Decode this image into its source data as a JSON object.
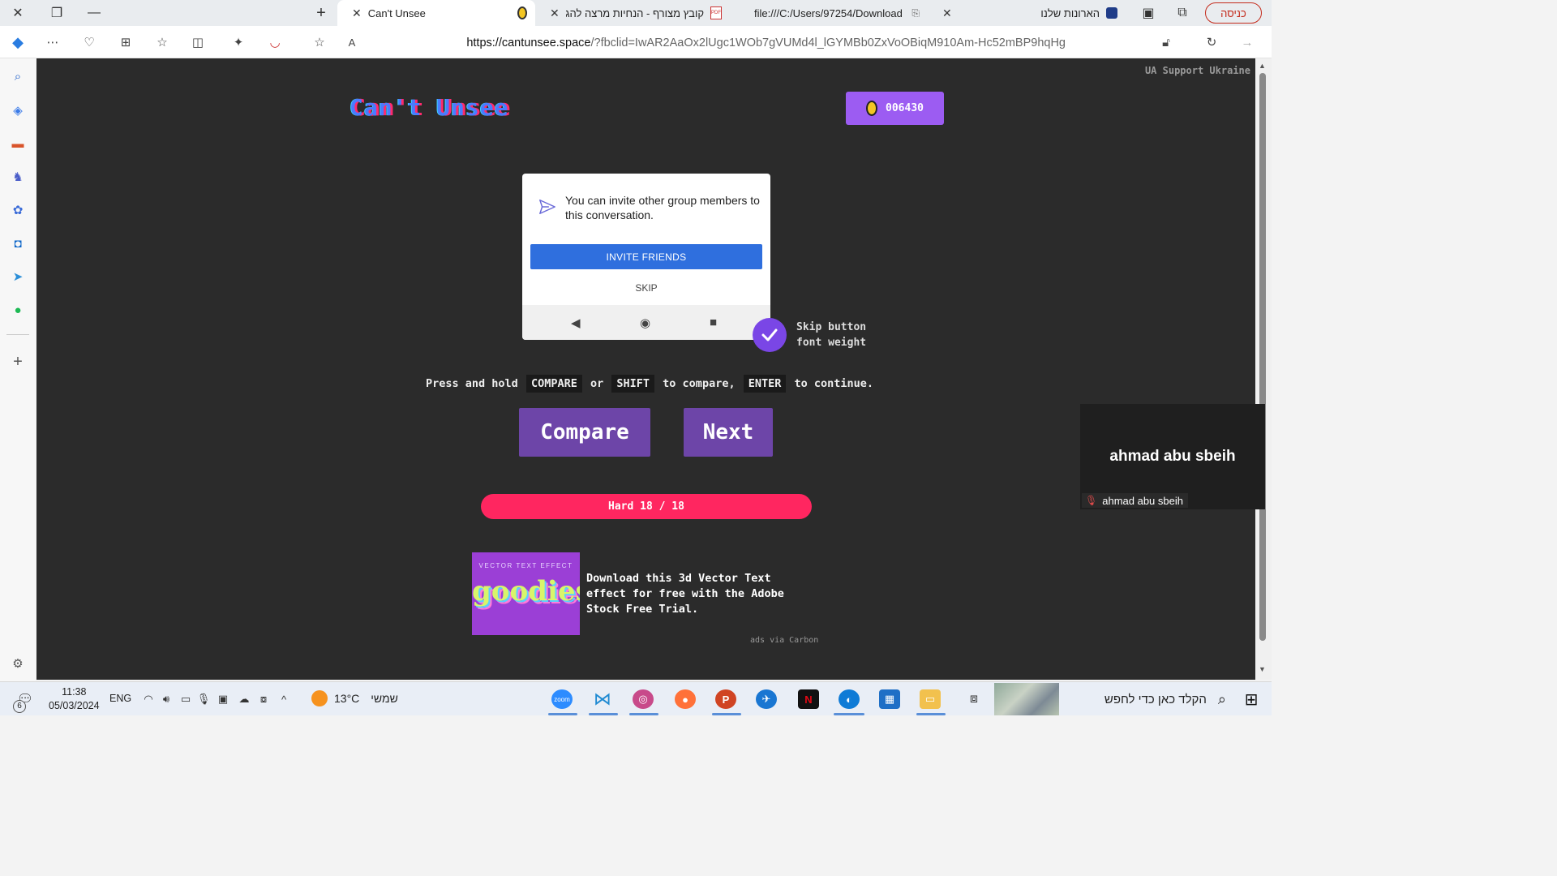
{
  "browser": {
    "tabs": [
      {
        "title": "Can't Unsee",
        "active": true
      },
      {
        "title": "קובץ מצורף - הנחיות מרצה להגש",
        "active": false
      },
      {
        "title": "file:///C:/Users/97254/Download",
        "active": false
      },
      {
        "title": "הארונות שלנו",
        "active": false
      }
    ],
    "login_label": "כניסה",
    "url_domain": "https://cantunsee.space",
    "url_rest": "/?fbclid=IwAR2AaOx2lUgc1WOb7gVUMd4l_lGYMBb0ZxVoOBiqM910Am-Hc52mBP9hqHg"
  },
  "page": {
    "support_text": "UA Support Ukraine",
    "logo": "Can't Unsee",
    "coins": "006430",
    "dialog": {
      "message": "You can invite other group members to this conversation.",
      "invite_label": "INVITE FRIENDS",
      "skip_label": "SKIP"
    },
    "skip_note_line1": "Skip button",
    "skip_note_line2": "font weight",
    "instructions": {
      "p1": "Press and hold",
      "k1": "COMPARE",
      "p2": "or",
      "k2": "SHIFT",
      "p3": "to compare,",
      "k3": "ENTER",
      "p4": "to continue."
    },
    "compare_label": "Compare",
    "next_label": "Next",
    "level": "Hard 18 / 18",
    "ad": {
      "image_top": "VECTOR TEXT EFFECT",
      "image_word": "goodies",
      "text": "Download this 3d Vector Text effect for free with the Adobe Stock Free Trial.",
      "via": "ads via Carbon"
    }
  },
  "video_tile": {
    "name": "ahmad abu sbeih",
    "tag": "ahmad abu sbeih"
  },
  "taskbar": {
    "time": "11:38",
    "date": "05/03/2024",
    "lang": "ENG",
    "notif_count": "6",
    "temp": "13°C",
    "weather_label": "שמשי",
    "search_placeholder": "הקלד כאן כדי לחפש"
  }
}
